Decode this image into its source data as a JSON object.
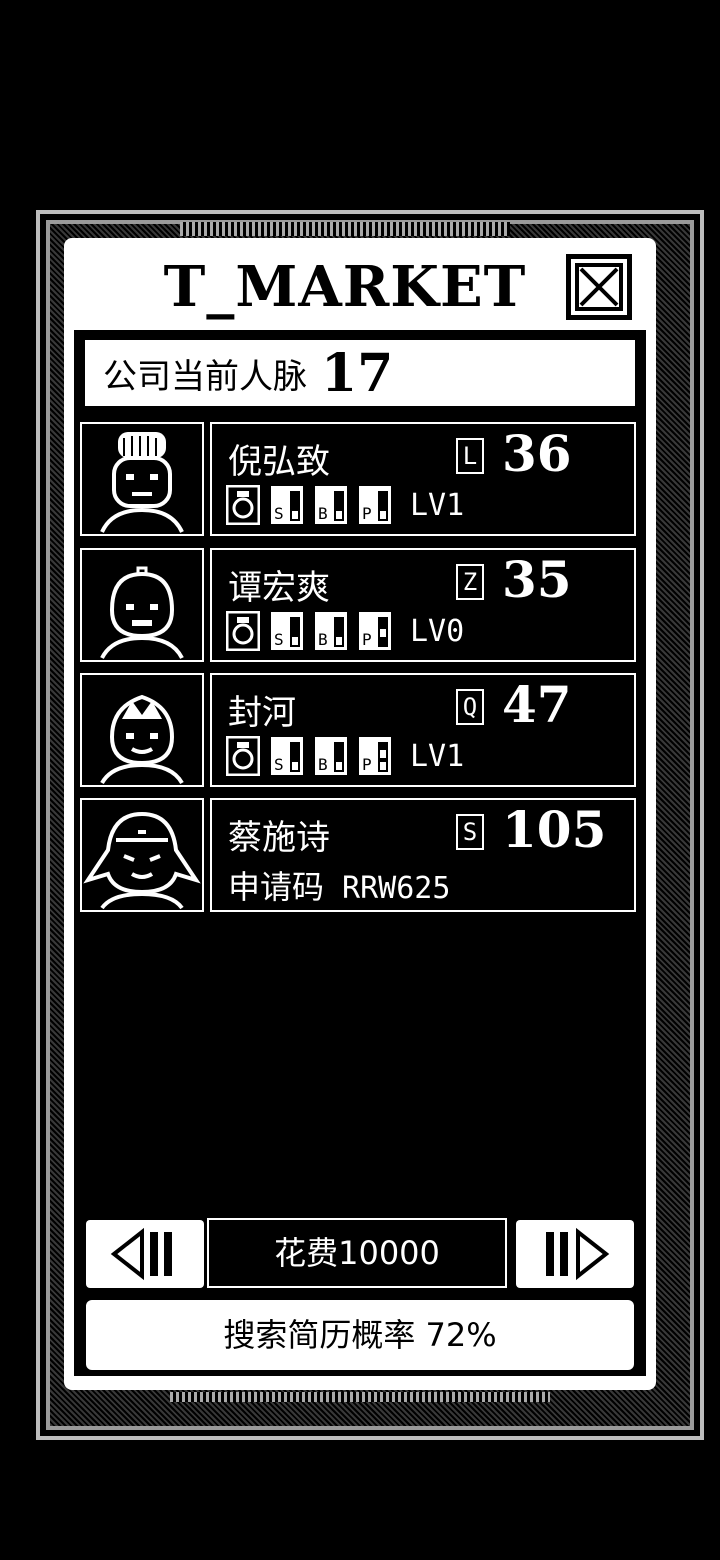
{
  "title": "T_MARKET",
  "network": {
    "label": "公司当前人脉",
    "value": "17"
  },
  "candidates": [
    {
      "name": "倪弘致",
      "rank": "L",
      "score": "36",
      "level": "LV1",
      "kind": "stats",
      "avatar": "chef-face-icon"
    },
    {
      "name": "谭宏爽",
      "rank": "Z",
      "score": "35",
      "level": "LV0",
      "kind": "stats",
      "avatar": "bald-face-icon"
    },
    {
      "name": "封河",
      "rank": "Q",
      "score": "47",
      "level": "LV1",
      "kind": "stats",
      "avatar": "spiky-hair-face-icon"
    },
    {
      "name": "蔡施诗",
      "rank": "S",
      "score": "105",
      "code_label": "申请码",
      "code": "RRW625",
      "kind": "code",
      "avatar": "long-hair-face-icon"
    }
  ],
  "footer": {
    "cost": "花费10000",
    "search_prob": "搜索简历概率 72%"
  },
  "colors": {
    "bg": "#000000",
    "fg": "#ffffff",
    "frame": "#bdbdbd"
  }
}
